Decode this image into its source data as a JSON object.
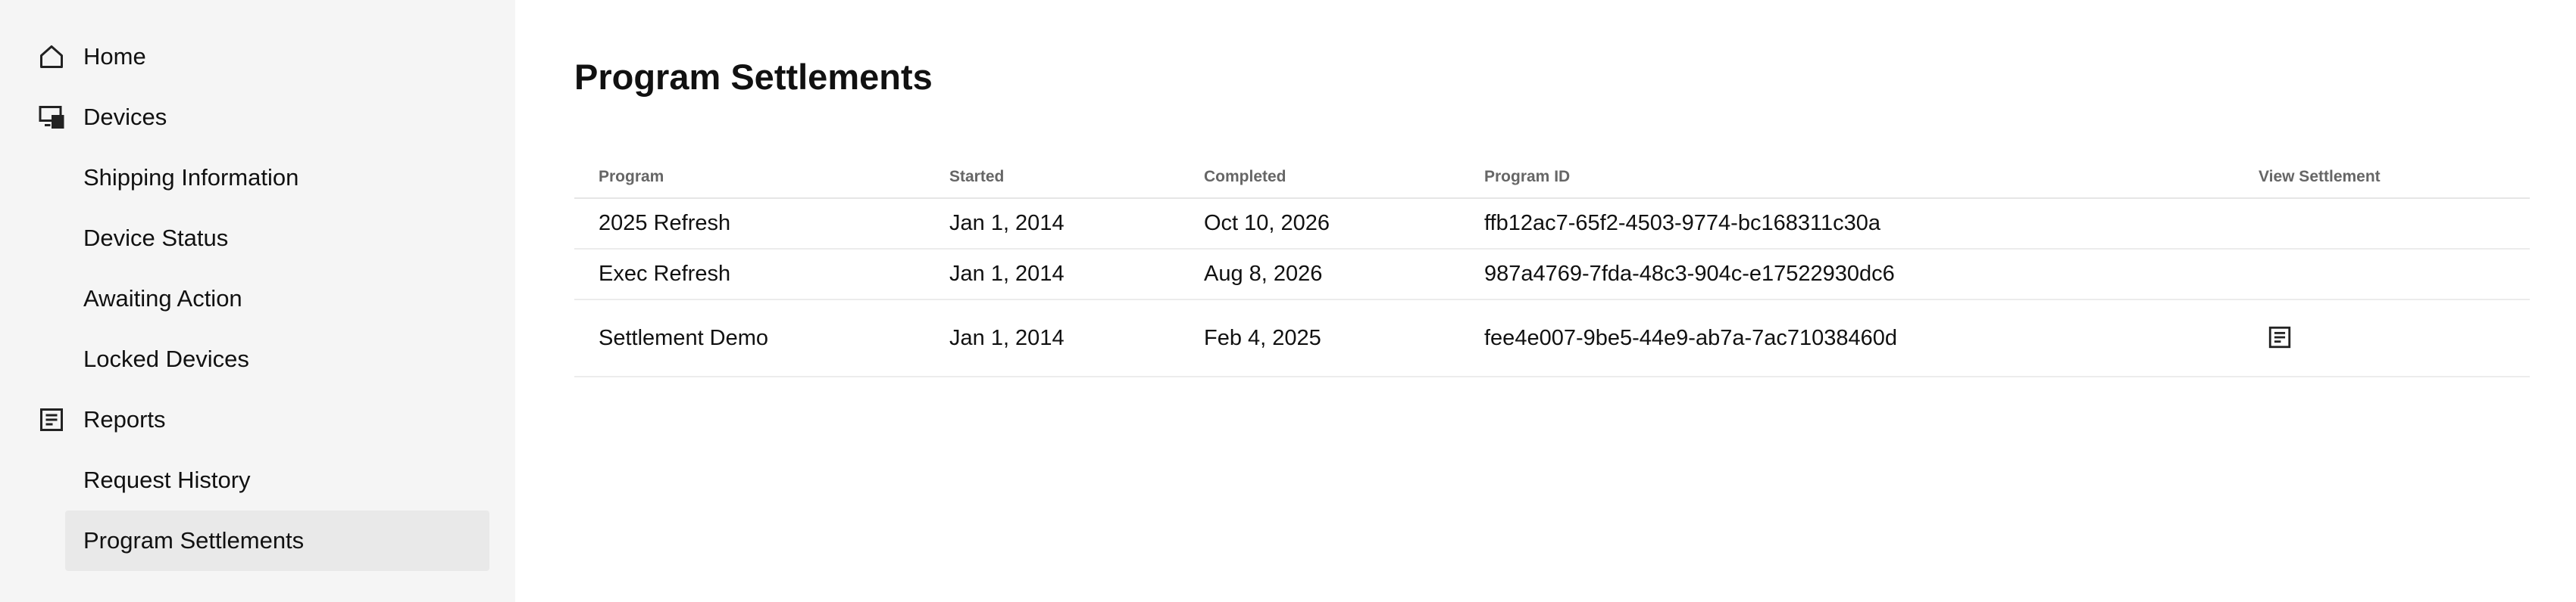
{
  "sidebar": {
    "home": {
      "label": "Home",
      "icon": "home-icon"
    },
    "devices": {
      "label": "Devices",
      "icon": "devices-icon"
    },
    "devices_sub": [
      {
        "label": "Shipping Information"
      },
      {
        "label": "Device Status"
      },
      {
        "label": "Awaiting Action"
      },
      {
        "label": "Locked Devices"
      }
    ],
    "reports": {
      "label": "Reports",
      "icon": "report-icon"
    },
    "reports_sub": [
      {
        "label": "Request History"
      },
      {
        "label": "Program Settlements",
        "active": true
      }
    ]
  },
  "main": {
    "title": "Program Settlements",
    "table": {
      "headers": {
        "program": "Program",
        "started": "Started",
        "completed": "Completed",
        "program_id": "Program ID",
        "view": "View Settlement"
      },
      "rows": [
        {
          "program": "2025 Refresh",
          "started": "Jan 1, 2014",
          "completed": "Oct 10, 2026",
          "program_id": "ffb12ac7-65f2-4503-9774-bc168311c30a",
          "has_settlement": false
        },
        {
          "program": "Exec Refresh",
          "started": "Jan 1, 2014",
          "completed": "Aug 8, 2026",
          "program_id": "987a4769-7fda-48c3-904c-e17522930dc6",
          "has_settlement": false
        },
        {
          "program": "Settlement Demo",
          "started": "Jan 1, 2014",
          "completed": "Feb 4, 2025",
          "program_id": "fee4e007-9be5-44e9-ab7a-7ac71038460d",
          "has_settlement": true,
          "view_icon": "document-icon"
        }
      ]
    }
  },
  "colors": {
    "sidebar_bg": "#f5f5f5",
    "active_item_bg": "#e9e9e9",
    "header_text": "#666666",
    "text": "#111111"
  }
}
